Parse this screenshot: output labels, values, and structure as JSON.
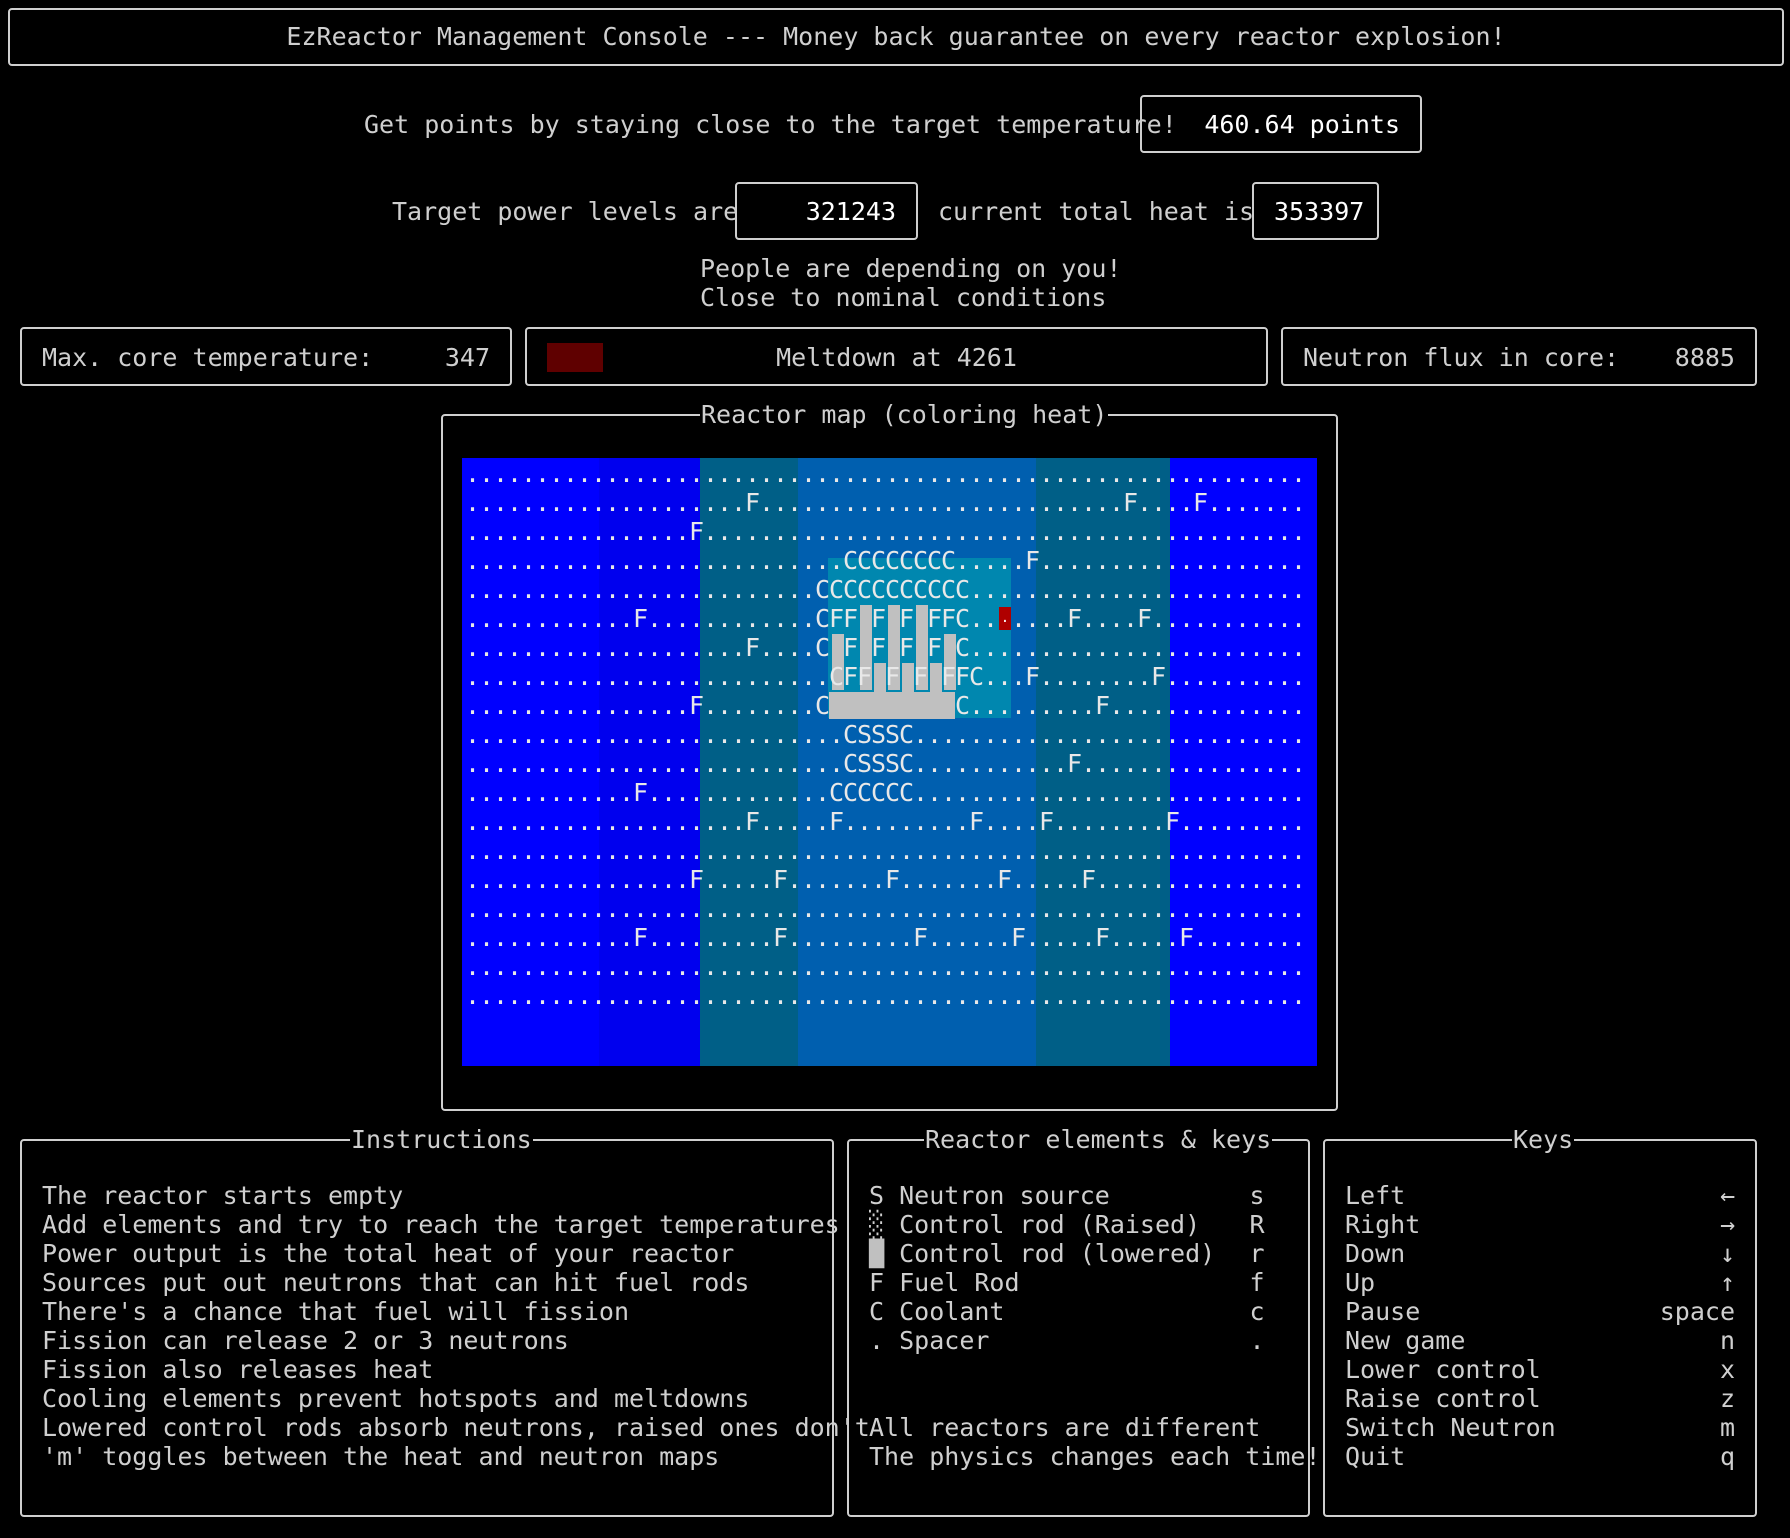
{
  "header": {
    "title": "EzReactor Management Console --- Money back guarantee on every reactor explosion!"
  },
  "score": {
    "prompt": "Get points by staying close to the target temperature!",
    "points": "460.64 points"
  },
  "power": {
    "target_label": "Target power levels are",
    "target_value": "321243",
    "heat_label": "current total heat is",
    "heat_value": "353397"
  },
  "status": {
    "line1": "People are depending on you!",
    "line2": "Close to nominal conditions"
  },
  "gauges": {
    "max_temp_label": "Max. core temperature:",
    "max_temp_value": "347",
    "meltdown_label": "Meltdown at 4261",
    "meltdown_fraction": 0.08,
    "flux_label": "Neutron flux in core:",
    "flux_value": "8885"
  },
  "map": {
    "title": "Reactor map (coloring heat)",
    "colors": {
      "cold": "#0000ff",
      "cool": "#0000ee",
      "mid": "#005f87",
      "warm": "#005faf",
      "hot": "#0087af",
      "hotspot": "#af0000",
      "rod": "#c0c0c0"
    },
    "rows": [
      ".............................................................",
      "....................F..........................F....F.........",
      "................F.............................................",
      "...........................CCCCCCCC.....F.....................",
      ".........................CCCCCCCCCCC..........................",
      "............F............CFF▐F▐F▐FFC..▮....F....F.............",
      "....................F....C▐F▐F▐F▐F▐C...........................",
      "..........................CFF▐F▐F▐FFC...F........F............",
      "................F........C█████████C.........F................",
      "...........................CSSSC..............................",
      "...........................CSSSC...........F..................",
      "............F.............CCCCCC...............................",
      "....................F.....F.........F....F........F............",
      "..............................................................",
      "................F.....F.......F.......F.....F.................",
      "..............................................................",
      "............F.........F.........F......F.....F.....F..........",
      "..............................................................",
      ".............................................................."
    ]
  },
  "instructions": {
    "title": "Instructions",
    "lines": [
      "The reactor starts empty",
      "Add elements and try to reach the target temperatures",
      "Power output is the total heat of your reactor",
      "Sources put out neutrons that can hit fuel rods",
      "There's a chance that fuel will fission",
      "Fission can release 2 or 3 neutrons",
      "Fission also releases heat",
      "Cooling elements prevent hotspots and meltdowns",
      "Lowered control rods absorb neutrons, raised ones don't",
      "'m' toggles between the heat and neutron maps"
    ]
  },
  "elements": {
    "title": "Reactor elements & keys",
    "items": [
      {
        "symbol": "S",
        "name": "Neutron source",
        "key": "s"
      },
      {
        "symbol": "░",
        "name": "Control rod (Raised)",
        "key": "R"
      },
      {
        "symbol": "█",
        "name": "Control rod (lowered)",
        "key": "r"
      },
      {
        "symbol": "F",
        "name": "Fuel Rod",
        "key": "f"
      },
      {
        "symbol": "C",
        "name": "Coolant",
        "key": "c"
      },
      {
        "symbol": ".",
        "name": "Spacer",
        "key": "."
      }
    ],
    "note1": "All reactors are different",
    "note2": "The physics changes each time!"
  },
  "keys": {
    "title": "Keys",
    "items": [
      {
        "action": "Left",
        "key": "←"
      },
      {
        "action": "Right",
        "key": "→"
      },
      {
        "action": "Down",
        "key": "↓"
      },
      {
        "action": "Up",
        "key": "↑"
      },
      {
        "action": "Pause",
        "key": "space"
      },
      {
        "action": "New game",
        "key": "n"
      },
      {
        "action": "Lower control",
        "key": "x"
      },
      {
        "action": "Raise control",
        "key": "z"
      },
      {
        "action": "Switch Neutron",
        "key": "m"
      },
      {
        "action": "Quit",
        "key": "q"
      }
    ]
  }
}
